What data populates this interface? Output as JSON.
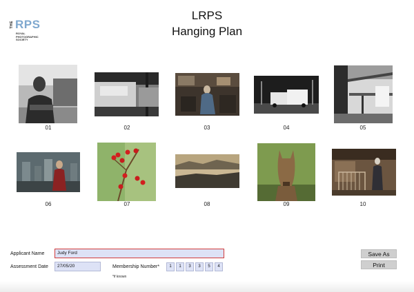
{
  "logo": {
    "prefix": "THE",
    "mark": "RPS",
    "line1": "ROYAL",
    "line2": "PHOTOGRAPHIC",
    "line3": "SOCIETY"
  },
  "header": {
    "title": "LRPS",
    "subtitle": "Hanging Plan"
  },
  "photos": [
    {
      "number": "01",
      "subject": "man-arms-crossed-bw"
    },
    {
      "number": "02",
      "subject": "moving-train-bw"
    },
    {
      "number": "03",
      "subject": "craftsman-workshop"
    },
    {
      "number": "04",
      "subject": "trucks-night-bw"
    },
    {
      "number": "05",
      "subject": "building-scaffold-bw"
    },
    {
      "number": "06",
      "subject": "woman-in-graveyard"
    },
    {
      "number": "07",
      "subject": "red-berries-branch"
    },
    {
      "number": "08",
      "subject": "misty-valley-sunrise"
    },
    {
      "number": "09",
      "subject": "wild-pony-field"
    },
    {
      "number": "10",
      "subject": "woman-at-gate"
    }
  ],
  "form": {
    "applicant_label": "Applicant Name",
    "applicant_value": "Judy Ford",
    "date_label": "Assessment Date",
    "date_value": "27/05/20",
    "membership_label": "Membership Number",
    "membership_asterisk": "*",
    "membership_digits": [
      "1",
      "1",
      "3",
      "3",
      "5",
      "4"
    ],
    "membership_note": "*if known"
  },
  "actions": {
    "save_label": "Save As",
    "print_label": "Print"
  },
  "colors": {
    "field_bg": "#dde2f6",
    "error_border": "#d13b3b",
    "logo_blue": "#7fa8cf",
    "button_bg": "#cfcfcf"
  }
}
